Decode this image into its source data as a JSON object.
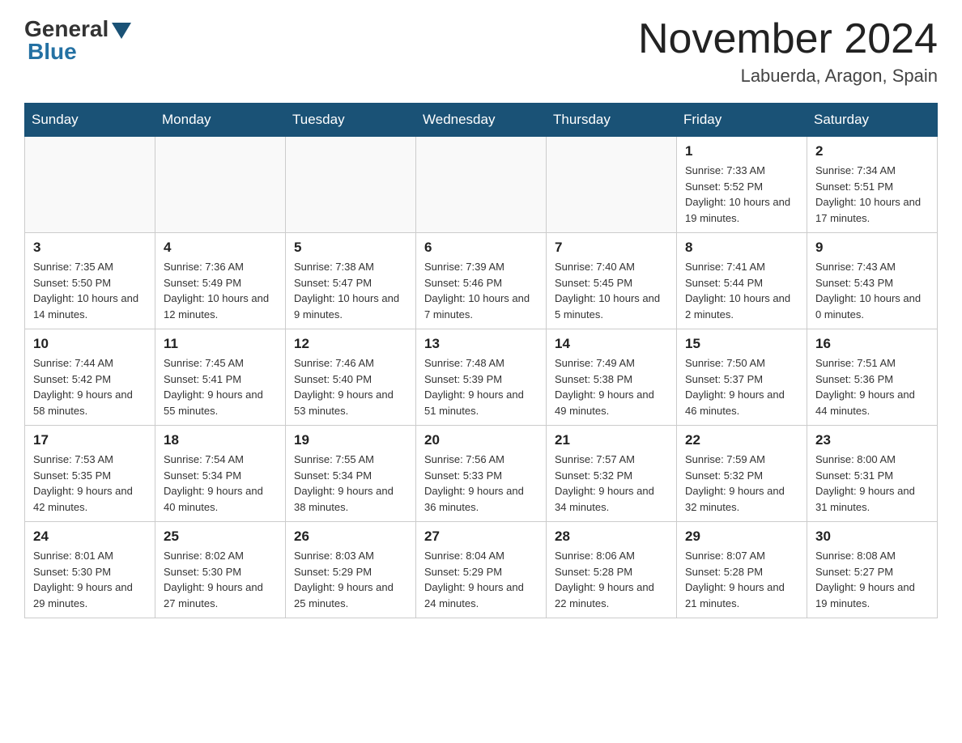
{
  "header": {
    "logo_general": "General",
    "logo_blue": "Blue",
    "month_title": "November 2024",
    "location": "Labuerda, Aragon, Spain"
  },
  "weekdays": [
    "Sunday",
    "Monday",
    "Tuesday",
    "Wednesday",
    "Thursday",
    "Friday",
    "Saturday"
  ],
  "weeks": [
    [
      {
        "day": "",
        "info": ""
      },
      {
        "day": "",
        "info": ""
      },
      {
        "day": "",
        "info": ""
      },
      {
        "day": "",
        "info": ""
      },
      {
        "day": "",
        "info": ""
      },
      {
        "day": "1",
        "info": "Sunrise: 7:33 AM\nSunset: 5:52 PM\nDaylight: 10 hours and 19 minutes."
      },
      {
        "day": "2",
        "info": "Sunrise: 7:34 AM\nSunset: 5:51 PM\nDaylight: 10 hours and 17 minutes."
      }
    ],
    [
      {
        "day": "3",
        "info": "Sunrise: 7:35 AM\nSunset: 5:50 PM\nDaylight: 10 hours and 14 minutes."
      },
      {
        "day": "4",
        "info": "Sunrise: 7:36 AM\nSunset: 5:49 PM\nDaylight: 10 hours and 12 minutes."
      },
      {
        "day": "5",
        "info": "Sunrise: 7:38 AM\nSunset: 5:47 PM\nDaylight: 10 hours and 9 minutes."
      },
      {
        "day": "6",
        "info": "Sunrise: 7:39 AM\nSunset: 5:46 PM\nDaylight: 10 hours and 7 minutes."
      },
      {
        "day": "7",
        "info": "Sunrise: 7:40 AM\nSunset: 5:45 PM\nDaylight: 10 hours and 5 minutes."
      },
      {
        "day": "8",
        "info": "Sunrise: 7:41 AM\nSunset: 5:44 PM\nDaylight: 10 hours and 2 minutes."
      },
      {
        "day": "9",
        "info": "Sunrise: 7:43 AM\nSunset: 5:43 PM\nDaylight: 10 hours and 0 minutes."
      }
    ],
    [
      {
        "day": "10",
        "info": "Sunrise: 7:44 AM\nSunset: 5:42 PM\nDaylight: 9 hours and 58 minutes."
      },
      {
        "day": "11",
        "info": "Sunrise: 7:45 AM\nSunset: 5:41 PM\nDaylight: 9 hours and 55 minutes."
      },
      {
        "day": "12",
        "info": "Sunrise: 7:46 AM\nSunset: 5:40 PM\nDaylight: 9 hours and 53 minutes."
      },
      {
        "day": "13",
        "info": "Sunrise: 7:48 AM\nSunset: 5:39 PM\nDaylight: 9 hours and 51 minutes."
      },
      {
        "day": "14",
        "info": "Sunrise: 7:49 AM\nSunset: 5:38 PM\nDaylight: 9 hours and 49 minutes."
      },
      {
        "day": "15",
        "info": "Sunrise: 7:50 AM\nSunset: 5:37 PM\nDaylight: 9 hours and 46 minutes."
      },
      {
        "day": "16",
        "info": "Sunrise: 7:51 AM\nSunset: 5:36 PM\nDaylight: 9 hours and 44 minutes."
      }
    ],
    [
      {
        "day": "17",
        "info": "Sunrise: 7:53 AM\nSunset: 5:35 PM\nDaylight: 9 hours and 42 minutes."
      },
      {
        "day": "18",
        "info": "Sunrise: 7:54 AM\nSunset: 5:34 PM\nDaylight: 9 hours and 40 minutes."
      },
      {
        "day": "19",
        "info": "Sunrise: 7:55 AM\nSunset: 5:34 PM\nDaylight: 9 hours and 38 minutes."
      },
      {
        "day": "20",
        "info": "Sunrise: 7:56 AM\nSunset: 5:33 PM\nDaylight: 9 hours and 36 minutes."
      },
      {
        "day": "21",
        "info": "Sunrise: 7:57 AM\nSunset: 5:32 PM\nDaylight: 9 hours and 34 minutes."
      },
      {
        "day": "22",
        "info": "Sunrise: 7:59 AM\nSunset: 5:32 PM\nDaylight: 9 hours and 32 minutes."
      },
      {
        "day": "23",
        "info": "Sunrise: 8:00 AM\nSunset: 5:31 PM\nDaylight: 9 hours and 31 minutes."
      }
    ],
    [
      {
        "day": "24",
        "info": "Sunrise: 8:01 AM\nSunset: 5:30 PM\nDaylight: 9 hours and 29 minutes."
      },
      {
        "day": "25",
        "info": "Sunrise: 8:02 AM\nSunset: 5:30 PM\nDaylight: 9 hours and 27 minutes."
      },
      {
        "day": "26",
        "info": "Sunrise: 8:03 AM\nSunset: 5:29 PM\nDaylight: 9 hours and 25 minutes."
      },
      {
        "day": "27",
        "info": "Sunrise: 8:04 AM\nSunset: 5:29 PM\nDaylight: 9 hours and 24 minutes."
      },
      {
        "day": "28",
        "info": "Sunrise: 8:06 AM\nSunset: 5:28 PM\nDaylight: 9 hours and 22 minutes."
      },
      {
        "day": "29",
        "info": "Sunrise: 8:07 AM\nSunset: 5:28 PM\nDaylight: 9 hours and 21 minutes."
      },
      {
        "day": "30",
        "info": "Sunrise: 8:08 AM\nSunset: 5:27 PM\nDaylight: 9 hours and 19 minutes."
      }
    ]
  ]
}
